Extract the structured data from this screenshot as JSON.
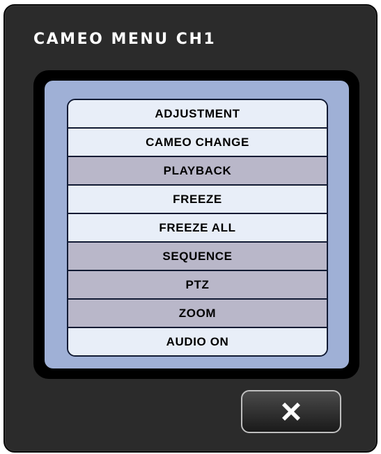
{
  "dialog": {
    "title": "CAMEO MENU CH1"
  },
  "menu": {
    "items": [
      {
        "label": "ADJUSTMENT",
        "state": "active"
      },
      {
        "label": "CAMEO CHANGE",
        "state": "active"
      },
      {
        "label": "PLAYBACK",
        "state": "inactive"
      },
      {
        "label": "FREEZE",
        "state": "active"
      },
      {
        "label": "FREEZE ALL",
        "state": "active"
      },
      {
        "label": "SEQUENCE",
        "state": "inactive"
      },
      {
        "label": "PTZ",
        "state": "inactive"
      },
      {
        "label": "ZOOM",
        "state": "inactive"
      },
      {
        "label": "AUDIO ON",
        "state": "active"
      }
    ]
  },
  "close_button": {
    "icon": "close-icon"
  },
  "colors": {
    "dialog_background": "#2b2b2b",
    "panel_background": "#9fb0d6",
    "item_active": "#e8eef8",
    "item_inactive": "#b9b7c9"
  }
}
